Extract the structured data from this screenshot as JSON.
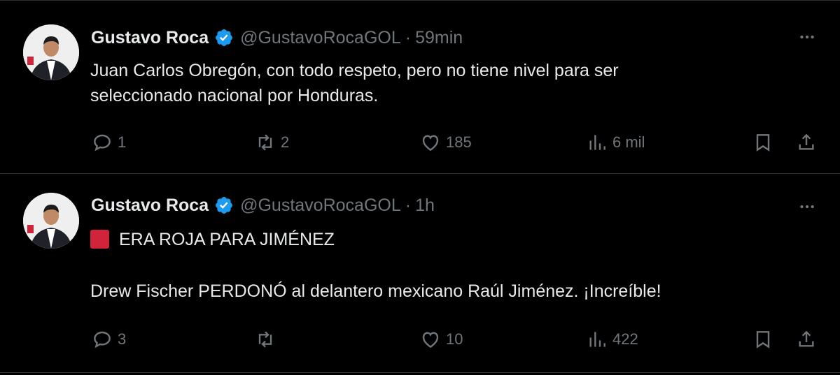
{
  "colors": {
    "background": "#000000",
    "text": "#e7e9ea",
    "muted": "#71767b",
    "verified": "#1d9bf0",
    "divider": "#2f3336",
    "red_square": "#d0243a"
  },
  "tweets": [
    {
      "author_name": "Gustavo Roca",
      "handle": "@GustavoRocaGOL",
      "separator": "·",
      "time": "59min",
      "text_line1": "Juan Carlos Obregón, con todo respeto, pero no tiene nivel para ser",
      "text_line2": "seleccionado nacional por Honduras.",
      "replies": "1",
      "retweets": "2",
      "likes": "185",
      "views": "6 mil"
    },
    {
      "author_name": "Gustavo Roca",
      "handle": "@GustavoRocaGOL",
      "separator": "·",
      "time": "1h",
      "text_line1": "ERA ROJA PARA JIMÉNEZ",
      "text_line2": "Drew Fischer PERDONÓ al delantero mexicano Raúl Jiménez. ¡Increíble!",
      "replies": "3",
      "retweets": "",
      "likes": "10",
      "views": "422"
    }
  ],
  "icons": [
    "reply-icon",
    "retweet-icon",
    "like-icon",
    "views-icon",
    "bookmark-icon",
    "share-icon",
    "more-icon",
    "verified-icon",
    "red-square-emoji"
  ]
}
